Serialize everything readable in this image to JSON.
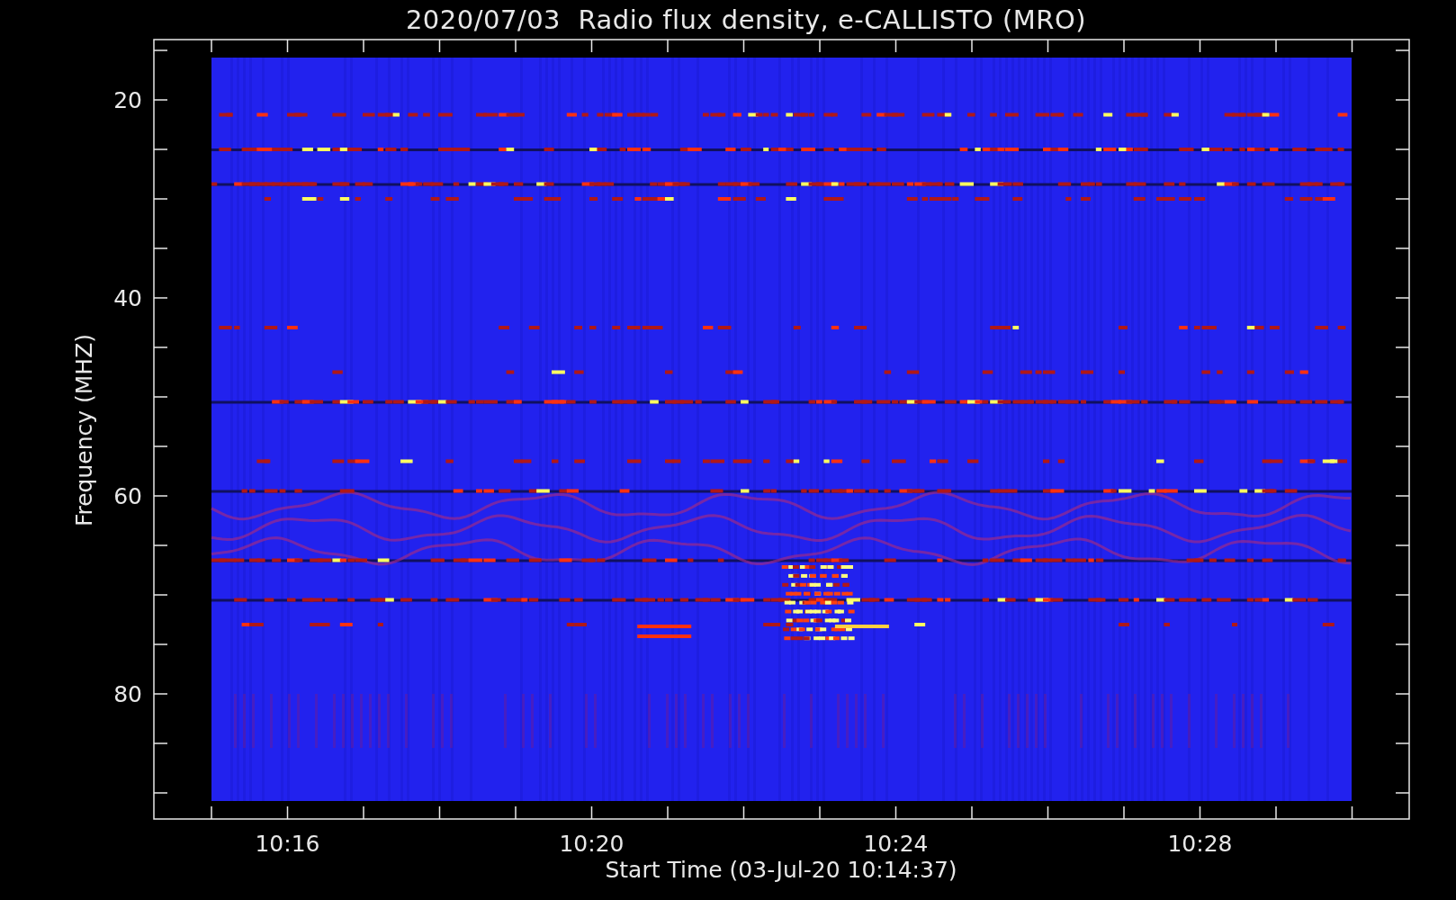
{
  "title": "2020/07/03  Radio flux density, e-CALLISTO (MRO)",
  "y_axis": {
    "label": "Frequency (MHZ)",
    "ticks": [
      "20",
      "40",
      "60",
      "80"
    ]
  },
  "x_axis": {
    "label": "Start Time (03-Jul-20 10:14:37)",
    "ticks": [
      "10:16",
      "10:20",
      "10:24",
      "10:28"
    ]
  }
}
